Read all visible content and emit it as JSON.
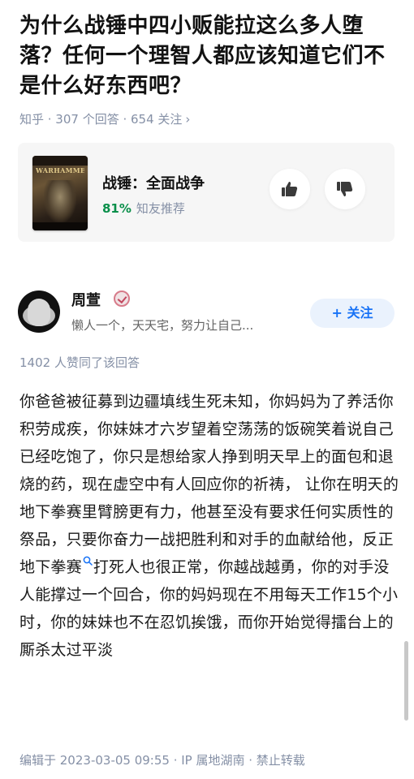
{
  "question": {
    "title": "为什么战锤中四小贩能拉这么多人堕落？任何一个理智人都应该知道它们不是什么好东西吧？",
    "meta": "知乎 · 307 个回答 · 654 关注",
    "meta_chevron": "›"
  },
  "topic_card": {
    "cover_logo": "WARHAMMER",
    "game_title": "战锤：全面战争",
    "rec_percent": "81%",
    "rec_label": "知友推荐",
    "upvote_icon": "thumbs-up-icon",
    "downvote_icon": "thumbs-down-icon"
  },
  "author": {
    "name": "周萱",
    "bio": "懒人一个，天天宅，努力让自己...",
    "follow_label": "+ 关注",
    "badge_icon": "verified-badge-icon"
  },
  "answer": {
    "vote_count": "1402 人赞同了该回答",
    "body_part1": "你爸爸被征募到边疆填线生死未知，你妈妈为了养活你积劳成疾，你妹妹才六岁望着空荡荡的饭碗笑着说自己已经吃饱了，你只是想给家人挣到明天早上的面包和退烧的药，现在虚空中有人回应你的祈祷， 让你在明天的地下拳赛里臂膀更有力，他甚至没有要求任何实质性的祭品，只要你奋力一战把胜利和对手的血献给他，反正",
    "body_keyword": "地下拳赛",
    "body_part2": "打死人也很正常，你越战越勇，你的对手没人能撑过一个回合，你的妈妈现在不用每天工作15个小时，你的妹妹也不在忍饥挨饿，而你开始觉得擂台上的厮杀太过平淡",
    "footer": "编辑于 2023-03-05 09:55 · IP 属地湖南 · 禁止转载"
  },
  "colors": {
    "accent": "#1772f6",
    "recommend_green": "#0a8f4a",
    "meta_gray": "#8590a6"
  }
}
